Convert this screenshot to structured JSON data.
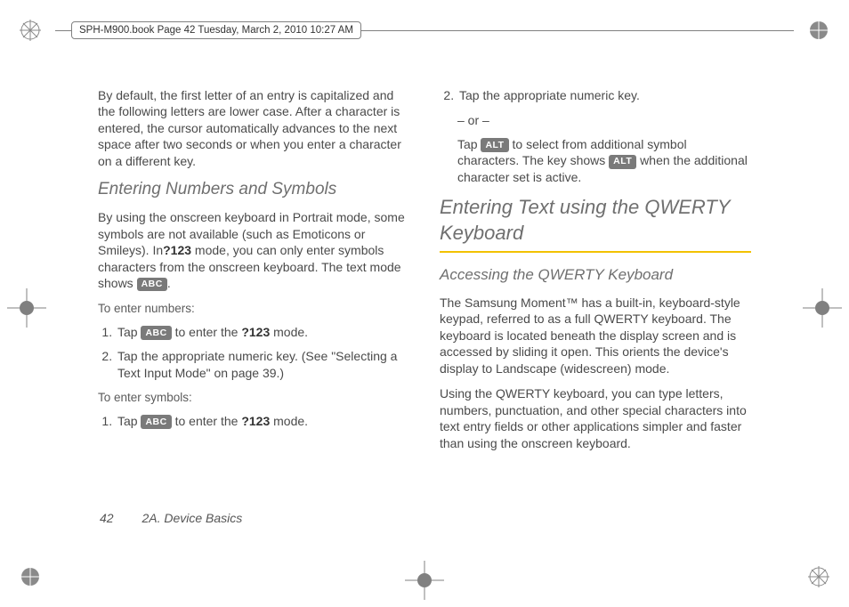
{
  "doc_meta": {
    "header_tab": "SPH-M900.book  Page 42  Tuesday, March 2, 2010  10:27 AM"
  },
  "col_left": {
    "intro_para": "By default, the first letter of an entry is capitalized and the following letters are lower case. After a character is entered, the cursor automatically advances to the next space after two seconds or when you enter a character on a different key.",
    "h_numbers_symbols": "Entering Numbers and Symbols",
    "nums_para_pre": "By using the onscreen keyboard in Portrait mode, some symbols are not available (such as Emoticons or Smileys). In",
    "nums_para_mode_bold": "?123",
    "nums_para_mid": " mode, you can only enter symbols characters from the onscreen keyboard. The text mode shows ",
    "nums_para_key": "ABC",
    "nums_para_post": ".",
    "to_enter_numbers_label": "To enter numbers:",
    "step_num_1_pre": "Tap ",
    "step_num_1_key": "ABC",
    "step_num_1_mid": " to enter the ",
    "step_num_1_bold": "?123",
    "step_num_1_post": " mode.",
    "step_num_2": "Tap the appropriate numeric key. (See \"Selecting a Text Input Mode\" on page 39.)",
    "to_enter_symbols_label": "To enter symbols:",
    "step_sym_1_pre": "Tap ",
    "step_sym_1_key": "ABC",
    "step_sym_1_mid": " to enter the ",
    "step_sym_1_bold": "?123",
    "step_sym_1_post": " mode."
  },
  "col_right": {
    "step_sym_2": "Tap the appropriate numeric key.",
    "or_sep": "– or –",
    "sym_alt_pre": "Tap ",
    "sym_alt_key1": "ALT",
    "sym_alt_mid1": " to select from additional symbol characters. The key shows ",
    "sym_alt_key2": "ALT",
    "sym_alt_post": " when the additional character set is active.",
    "h_qwerty_title": "Entering Text using the QWERTY Keyboard",
    "h_access_qwerty": "Accessing the QWERTY Keyboard",
    "qwerty_para1": "The Samsung Moment™ has a built-in, keyboard-style keypad, referred to as a full QWERTY keyboard. The keyboard is located beneath the display screen and is accessed by sliding it open. This orients the device's display to Landscape (widescreen) mode.",
    "qwerty_para2": "Using the QWERTY keyboard, you can type letters, numbers, punctuation, and other special characters into text entry fields or other applications simpler and faster than using the onscreen keyboard."
  },
  "footer": {
    "page_number": "42",
    "section": "2A. Device Basics"
  }
}
